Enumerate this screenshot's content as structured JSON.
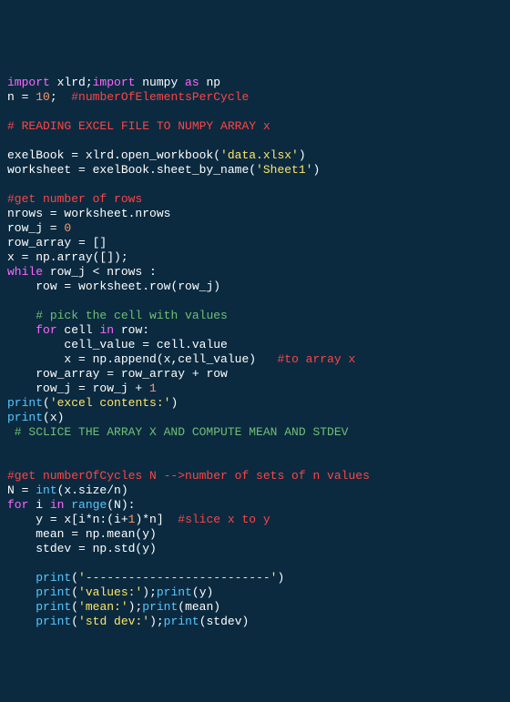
{
  "line1": {
    "kw1": "import",
    "t1": " xlrd;",
    "kw2": "import",
    "t2": " numpy ",
    "kw3": "as",
    "t3": " np"
  },
  "line2": {
    "t1": "n = ",
    "num": "10",
    "t2": ";  ",
    "cmt": "#numberOfElementsPerCycle"
  },
  "line3": {
    "cmt": "# READING EXCEL FILE TO NUMPY ARRAY x"
  },
  "line4": {
    "t1": "exelBook = xlrd.open_workbook(",
    "str": "'data.xlsx'",
    "t2": ")"
  },
  "line5": {
    "t1": "worksheet = exelBook.sheet_by_name(",
    "str": "'Sheet1'",
    "t2": ")"
  },
  "line6": {
    "cmt": "#get number of rows"
  },
  "line7": {
    "t1": "nrows = worksheet.nrows"
  },
  "line8": {
    "t1": "row_j = ",
    "num": "0"
  },
  "line9": {
    "t1": "row_array = []"
  },
  "line10": {
    "t1": "x = np.array([]);"
  },
  "line11": {
    "kw": "while",
    "t1": " row_j < nrows :"
  },
  "line12": {
    "ind": "    ",
    "t1": "row = worksheet.row(row_j)"
  },
  "line13": {
    "ind": "    ",
    "cmt": "# pick the cell with values"
  },
  "line14": {
    "ind": "    ",
    "kw1": "for",
    "t1": " cell ",
    "kw2": "in",
    "t2": " row:"
  },
  "line15": {
    "ind": "        ",
    "t1": "cell_value = cell.value"
  },
  "line16": {
    "ind": "        ",
    "t1": "x = np.append(x,cell_value)   ",
    "cmt": "#to array x"
  },
  "line17": {
    "ind": "    ",
    "t1": "row_array = row_array + row"
  },
  "line18": {
    "ind": "    ",
    "t1": "row_j = row_j + ",
    "num": "1"
  },
  "line19": {
    "bi": "print",
    "t1": "(",
    "str": "'excel contents:'",
    "t2": ")"
  },
  "line20": {
    "bi": "print",
    "t1": "(x)"
  },
  "line21": {
    "cmt": " # SCLICE THE ARRAY X AND COMPUTE MEAN AND STDEV"
  },
  "line22": {
    "cmt": "#get numberOfCycles N -->number of sets of n values"
  },
  "line23": {
    "t1": "N = ",
    "bi": "int",
    "t2": "(x.size/n)"
  },
  "line24": {
    "kw1": "for",
    "t1": " i ",
    "kw2": "in",
    "t2": " ",
    "bi": "range",
    "t3": "(N):"
  },
  "line25": {
    "ind": "    ",
    "t1": "y = x[i*n:(i+",
    "num": "1",
    "t2": ")*n]  ",
    "cmt": "#slice x to y"
  },
  "line26": {
    "ind": "    ",
    "t1": "mean = np.mean(y)"
  },
  "line27": {
    "ind": "    ",
    "t1": "stdev = np.std(y)"
  },
  "line28": {
    "ind": "    ",
    "bi": "print",
    "t1": "(",
    "str": "'--------------------------'",
    "t2": ")"
  },
  "line29": {
    "ind": "    ",
    "bi": "print",
    "t1": "(",
    "str": "'values:'",
    "t2": ");",
    "bi2": "print",
    "t3": "(y)"
  },
  "line30": {
    "ind": "    ",
    "bi": "print",
    "t1": "(",
    "str": "'mean:'",
    "t2": ");",
    "bi2": "print",
    "t3": "(mean)"
  },
  "line31": {
    "ind": "    ",
    "bi": "print",
    "t1": "(",
    "str": "'std dev:'",
    "t2": ");",
    "bi2": "print",
    "t3": "(stdev)"
  }
}
